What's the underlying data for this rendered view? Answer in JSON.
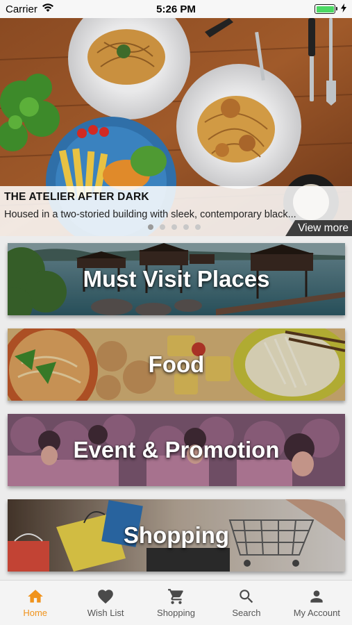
{
  "status_bar": {
    "carrier": "Carrier",
    "time": "5:26 PM",
    "battery_level": 1.0
  },
  "hero": {
    "title": "THE ATELIER AFTER DARK",
    "description": "Housed in a two-storied building with sleek, contemporary black...",
    "view_more_label": "View more",
    "slide_count": 5,
    "active_slide": 0
  },
  "categories": [
    {
      "label": "Must Visit Places"
    },
    {
      "label": "Food"
    },
    {
      "label": "Event & Promotion"
    },
    {
      "label": "Shopping"
    }
  ],
  "tab_bar": {
    "items": [
      {
        "label": "Home",
        "icon": "home-icon",
        "active": true
      },
      {
        "label": "Wish List",
        "icon": "heart-icon",
        "active": false
      },
      {
        "label": "Shopping",
        "icon": "cart-icon",
        "active": false
      },
      {
        "label": "Search",
        "icon": "search-icon",
        "active": false
      },
      {
        "label": "My Account",
        "icon": "person-icon",
        "active": false
      }
    ]
  },
  "colors": {
    "accent": "#f0931c",
    "tab_inactive": "#4a4a4a"
  }
}
